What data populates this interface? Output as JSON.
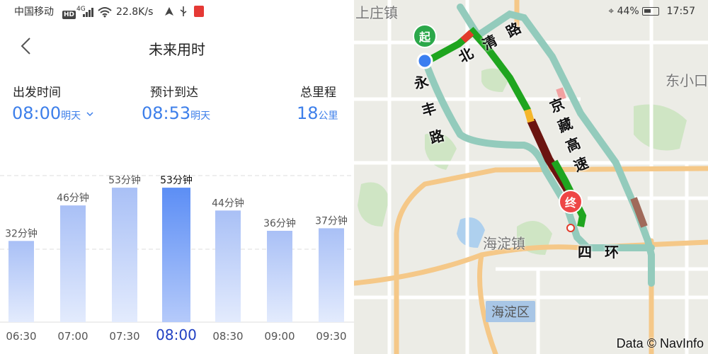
{
  "status_bar": {
    "carrier": "中国移动",
    "hd": "HD",
    "signal": "4G",
    "speed": "22.8K/s",
    "battery": "44%",
    "time": "17:57"
  },
  "nav": {
    "title": "未来用时",
    "back_icon": "chevron-left-icon"
  },
  "trip": {
    "depart_label": "出发时间",
    "depart_time": "08:00",
    "depart_day": "明天",
    "arrive_label": "预计到达",
    "arrive_time": "08:53",
    "arrive_day": "明天",
    "distance_label": "总里程",
    "distance_value": "18",
    "distance_unit": "公里"
  },
  "chart_data": {
    "type": "bar",
    "categories": [
      "06:30",
      "07:00",
      "07:30",
      "08:00",
      "08:30",
      "09:00",
      "09:30"
    ],
    "values": [
      32,
      46,
      53,
      53,
      44,
      36,
      37
    ],
    "value_labels": [
      "32分钟",
      "46分钟",
      "53分钟",
      "53分钟",
      "44分钟",
      "36分钟",
      "37分钟"
    ],
    "selected_index": 3,
    "ylim": [
      0,
      60
    ],
    "colors": {
      "bar": "#b8ccf8",
      "selected": "#5c8ef5",
      "selected_label": "#1f3fc2"
    }
  },
  "map": {
    "roads": {
      "north_qing": "北清路",
      "yong_feng": "永丰路",
      "jing_zang": "京藏高速",
      "fourth_ring": "四环"
    },
    "places": {
      "shangzhuang": "上庄镇",
      "dongxiaokou": "东小口",
      "haidian_town": "海淀镇",
      "haidian_district": "海淀区"
    },
    "start_marker": "起",
    "end_marker": "终",
    "credit": "Data © NavInfo",
    "colors": {
      "green": "#1fa51f",
      "dark_red": "#6b1410",
      "teal": "#93cbbc",
      "orange": "#f5c888",
      "start": "#2ba84a",
      "end": "#ee4646",
      "current": "#3a7ef0"
    }
  }
}
